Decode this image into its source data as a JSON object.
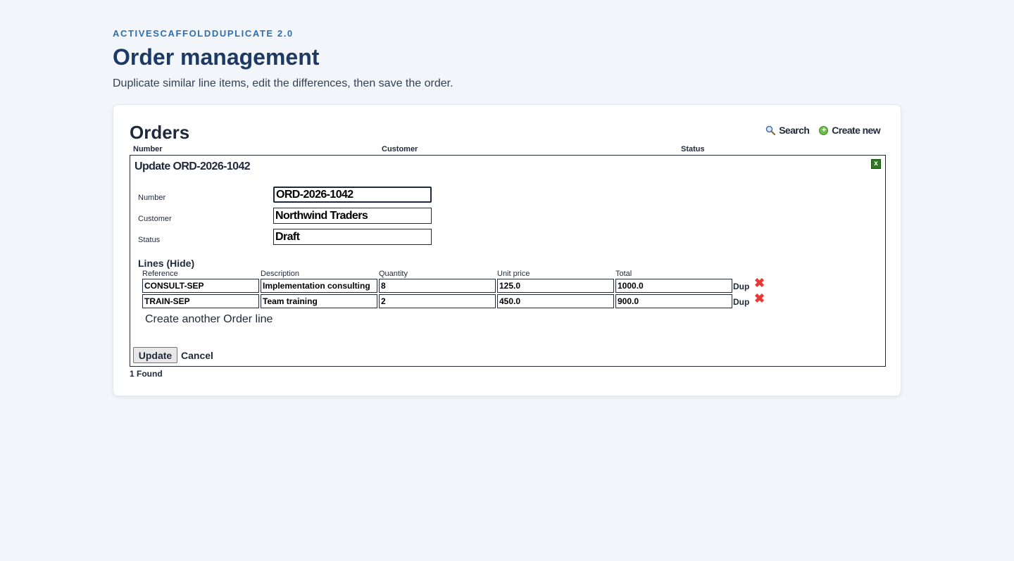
{
  "header": {
    "eyebrow": "ACTIVESCAFFOLDDUPLICATE 2.0",
    "title": "Order management",
    "subtitle": "Duplicate similar line items, edit the differences, then save the order."
  },
  "orders": {
    "title": "Orders",
    "search_label": "Search",
    "create_label": "Create new",
    "columns": [
      "Number",
      "Customer",
      "Status"
    ],
    "found_text": "1 Found"
  },
  "form": {
    "title": "Update ORD-2026-1042",
    "close_label": "x",
    "fields": [
      {
        "label": "Number",
        "value": "ORD-2026-1042"
      },
      {
        "label": "Customer",
        "value": "Northwind Traders"
      },
      {
        "label": "Status",
        "value": "Draft"
      }
    ],
    "lines_title": "Lines (Hide)",
    "line_columns": [
      "Reference",
      "Description",
      "Quantity",
      "Unit price",
      "Total"
    ],
    "lines": [
      {
        "reference": "CONSULT-SEP",
        "description": "Implementation consulting",
        "quantity": "8",
        "unit_price": "125.0",
        "total": "1000.0"
      },
      {
        "reference": "TRAIN-SEP",
        "description": "Team training",
        "quantity": "2",
        "unit_price": "450.0",
        "total": "900.0"
      }
    ],
    "dup_label": "Dup",
    "delete_glyph": "✖",
    "create_line_label": "Create another Order line",
    "update_label": "Update",
    "cancel_label": "Cancel"
  },
  "colors": {
    "eyebrow": "#2f6fb0",
    "title": "#1d3a66",
    "close_button": "#2c7a1f",
    "delete_icon": "#e53935",
    "create_icon": "#6cbd45"
  },
  "icons": {
    "search": "magnifier-icon",
    "create": "plus-circle-icon",
    "close": "close-icon",
    "delete": "delete-icon"
  }
}
